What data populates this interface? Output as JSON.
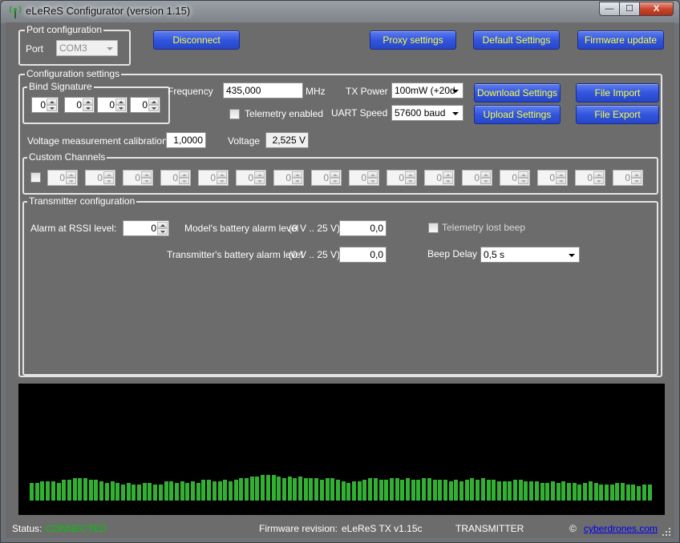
{
  "window": {
    "title": "eLeReS Configurator (version  1.15)",
    "caption_min": "—",
    "caption_max": "☐",
    "caption_close": "X"
  },
  "port": {
    "group_title": "Port configuration",
    "port_label": "Port",
    "port_value": "COM3",
    "disconnect": "Disconnect"
  },
  "toolbar": {
    "proxy": "Proxy settings",
    "defaults": "Default Settings",
    "firmware": "Firmware update"
  },
  "config": {
    "group_title": "Configuration settings",
    "bind_title": "Bind Signature",
    "bind_values": [
      "0",
      "0",
      "0",
      "0"
    ],
    "frequency_label": "Frequency",
    "frequency_value": "435,000",
    "frequency_unit": "MHz",
    "tx_power_label": "TX Power",
    "tx_power_value": "100mW (+20d",
    "telemetry_label": "Telemetry enabled",
    "uart_label": "UART Speed",
    "uart_value": "57600 baud",
    "download": "Download Settings",
    "upload": "Upload Settings",
    "import": "File Import",
    "export": "File Export",
    "vcal_label": "Voltage measurement calibration",
    "vcal_value": "1,0000",
    "voltage_label": "Voltage",
    "voltage_value": "2,525 V"
  },
  "custom": {
    "group_title": "Custom Channels",
    "values": [
      "0",
      "0",
      "0",
      "0",
      "0",
      "0",
      "0",
      "0",
      "0",
      "0",
      "0",
      "0",
      "0",
      "0",
      "0",
      "0"
    ]
  },
  "transmitter": {
    "group_title": "Transmitter configuration",
    "rssi_label": "Alarm at RSSI level:",
    "rssi_value": "0",
    "model_batt_label": "Model's battery alarm level",
    "model_batt_range": "(0 V .. 25 V)",
    "model_batt_value": "0,0",
    "tx_batt_label": "Transmitter's battery alarm level",
    "tx_batt_range": "(0 V .. 25 V)",
    "tx_batt_value": "0,0",
    "telemetry_lost_label": "Telemetry lost beep",
    "beep_delay_label": "Beep Delay",
    "beep_delay_value": "0,5 s"
  },
  "spectrum": {
    "bar_color": "#33b033",
    "levels": [
      0.55,
      0.55,
      0.6,
      0.6,
      0.6,
      0.55,
      0.65,
      0.65,
      0.7,
      0.7,
      0.7,
      0.65,
      0.65,
      0.6,
      0.55,
      0.6,
      0.55,
      0.5,
      0.55,
      0.5,
      0.5,
      0.55,
      0.55,
      0.5,
      0.5,
      0.6,
      0.6,
      0.55,
      0.6,
      0.55,
      0.6,
      0.55,
      0.65,
      0.65,
      0.6,
      0.6,
      0.65,
      0.6,
      0.65,
      0.7,
      0.7,
      0.75,
      0.75,
      0.8,
      0.8,
      0.8,
      0.75,
      0.7,
      0.75,
      0.7,
      0.75,
      0.7,
      0.7,
      0.7,
      0.65,
      0.7,
      0.7,
      0.65,
      0.6,
      0.55,
      0.6,
      0.6,
      0.65,
      0.7,
      0.7,
      0.65,
      0.65,
      0.7,
      0.7,
      0.65,
      0.7,
      0.65,
      0.65,
      0.7,
      0.7,
      0.65,
      0.65,
      0.65,
      0.6,
      0.65,
      0.6,
      0.65,
      0.7,
      0.65,
      0.7,
      0.65,
      0.65,
      0.6,
      0.6,
      0.6,
      0.65,
      0.65,
      0.6,
      0.6,
      0.6,
      0.55,
      0.55,
      0.6,
      0.55,
      0.6,
      0.55,
      0.55,
      0.5,
      0.55,
      0.6,
      0.55,
      0.5,
      0.5,
      0.5,
      0.55,
      0.55,
      0.5,
      0.5,
      0.45,
      0.5,
      0.5
    ]
  },
  "status": {
    "status_label": "Status:",
    "status_value": "CONNECTED",
    "status_color": "#00c800",
    "firmware_label": "Firmware revision:",
    "firmware_value": "eLeReS TX v1.15c",
    "mode": "TRANSMITTER",
    "copyright": "©",
    "link": "cyberdrones.com"
  }
}
